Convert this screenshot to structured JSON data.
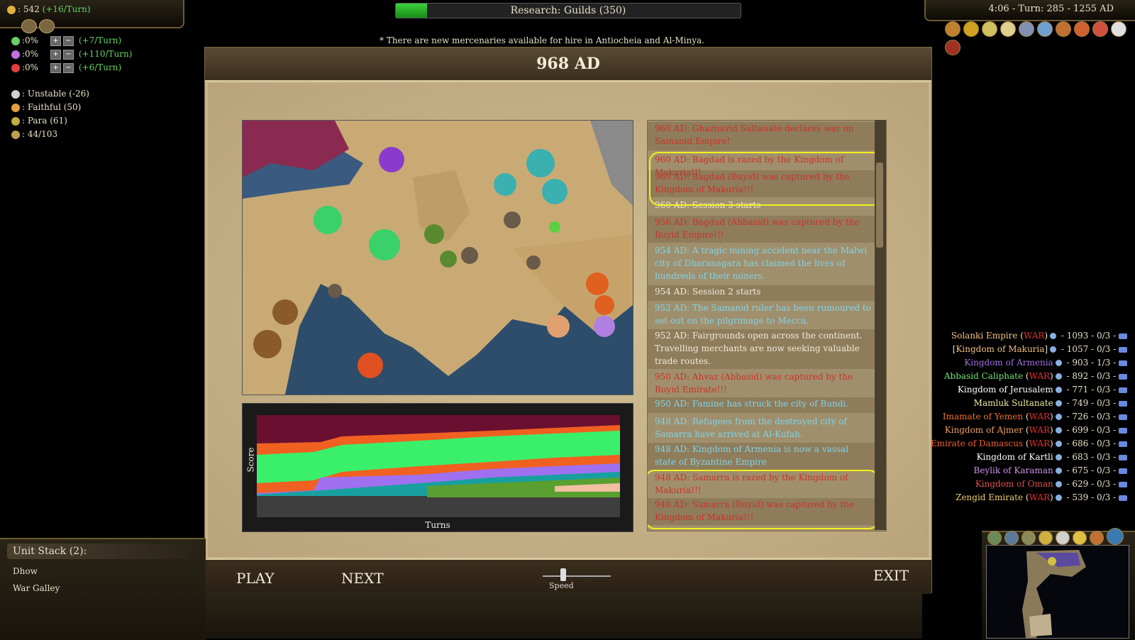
{
  "top_left": {
    "gold": ": 542",
    "gold_rate": "(+16/Turn)",
    "sliders": [
      {
        "value": ":0%",
        "rate": "(+7/Turn)",
        "color": "#6ad06a"
      },
      {
        "value": ":0%",
        "rate": "(+110/Turn)",
        "color": "#c070e0"
      },
      {
        "value": ":0%",
        "rate": "(+6/Turn)",
        "color": "#e04040"
      }
    ],
    "stability": ": Unstable (-26)",
    "religion": ": Faithful (50)",
    "civic": ": Para (61)",
    "units": ": 44/103"
  },
  "research": {
    "label": "Research: Guilds (350)",
    "progress": 0.09
  },
  "clock": "4:06 - Turn: 285 - 1255 AD",
  "message": "* There are new mercenaries available for hire in Antiocheia and Al-Minya.",
  "replay": {
    "title": "968 AD",
    "graph_ylabel": "Score",
    "graph_xlabel": "Turns",
    "log": [
      {
        "text": "960 AD: Ghaznavid Sultanate declares war on Samanid Empire!",
        "color": "red"
      },
      {
        "text": "960 AD: Bagdad is razed by the Kingdom of Makuria!!!",
        "color": "red"
      },
      {
        "text": "960 AD: Bagdad (Buyid) was captured by the Kingdom of Makuria!!!",
        "color": "red"
      },
      {
        "text": "960 AD: Session 3 starts",
        "color": "white"
      },
      {
        "text": "956 AD: Bagdad (Abbasid) was captured by the Buyid Empire!!!",
        "color": "red"
      },
      {
        "text": "954 AD: A tragic mining accident near the Malwi city of Dharanagara has claimed the lives of hundreds of their miners.",
        "color": "cyan"
      },
      {
        "text": "954 AD: Session 2 starts",
        "color": "white"
      },
      {
        "text": "952 AD: The Samanid ruler has been rumoured to set out on the pilgrimage to Mecca.",
        "color": "cyan"
      },
      {
        "text": "952 AD: Fairgrounds open across the continent. Travelling merchants are now seeking valuable trade routes.",
        "color": "white"
      },
      {
        "text": "950 AD: Ahvaz (Abbasid) was captured by the Buyid Emirate!!!",
        "color": "red"
      },
      {
        "text": "950 AD: Famine has struck the city of Bundi.",
        "color": "cyan"
      },
      {
        "text": "948 AD: Refugees from the destroyed city of Samarra have arrived at Al-Kufah.",
        "color": "cyan"
      },
      {
        "text": "948 AD: Kingdom of Armenia is now a vassal state of Byzantine Empire",
        "color": "cyan"
      },
      {
        "text": "948 AD: Samarra is razed by the Kingdom of Makuria!!!",
        "color": "red"
      },
      {
        "text": "948 AD: Samarra (Buyid) was captured by the Kingdom of Makuria!!!",
        "color": "red"
      }
    ],
    "buttons": {
      "play": "PLAY",
      "next": "NEXT",
      "exit": "EXIT",
      "speed": "Speed"
    },
    "speed_value": 0.3
  },
  "civs": [
    {
      "name": "Solanki Empire",
      "war": "WAR",
      "color": "#f0c080",
      "score": " - 1093 - 0/3 - ",
      "brackets": false
    },
    {
      "name": "Kingdom of Makuria",
      "war": "",
      "color": "#f0c080",
      "score": " - 1057 - 0/3 - ",
      "brackets": true
    },
    {
      "name": "Kingdom of Armenia",
      "war": "",
      "color": "#a070e0",
      "score": " - 903 - 1/3 - ",
      "brackets": false
    },
    {
      "name": "Abbasid Caliphate",
      "war": "WAR",
      "color": "#70e070",
      "score": " - 892 - 0/3 - ",
      "brackets": false
    },
    {
      "name": "Kingdom of Jerusalem",
      "war": "",
      "color": "#ffffff",
      "score": " - 771 - 0/3 - ",
      "brackets": false
    },
    {
      "name": "Mamluk Sultanate",
      "war": "",
      "color": "#f0f0a0",
      "score": " - 749 - 0/3 - ",
      "brackets": false
    },
    {
      "name": "Imamate of Yemen",
      "war": "WAR",
      "color": "#f07030",
      "score": " - 726 - 0/3 - ",
      "brackets": false
    },
    {
      "name": "Kingdom of Ajmer",
      "war": "WAR",
      "color": "#f0a060",
      "score": " - 699 - 0/3 - ",
      "brackets": false
    },
    {
      "name": "Emirate of Damascus",
      "war": "WAR",
      "color": "#f06030",
      "score": " - 686 - 0/3 - ",
      "brackets": false
    },
    {
      "name": "Kingdom of Kartli",
      "war": "",
      "color": "#ffffff",
      "score": " - 683 - 0/3 - ",
      "brackets": false
    },
    {
      "name": "Beylik of Karaman",
      "war": "",
      "color": "#d090f0",
      "score": " - 675 - 0/3 - ",
      "brackets": false
    },
    {
      "name": "Kingdom of Oman",
      "war": "",
      "color": "#e05050",
      "score": " - 629 - 0/3 - ",
      "brackets": false
    },
    {
      "name": "Zengid Emirate",
      "war": "WAR",
      "color": "#f0d070",
      "score": " - 539 - 0/3 - ",
      "brackets": false
    }
  ],
  "unit_stack": {
    "title": "Unit Stack (2):",
    "units": [
      "Dhow",
      "War Galley"
    ]
  }
}
